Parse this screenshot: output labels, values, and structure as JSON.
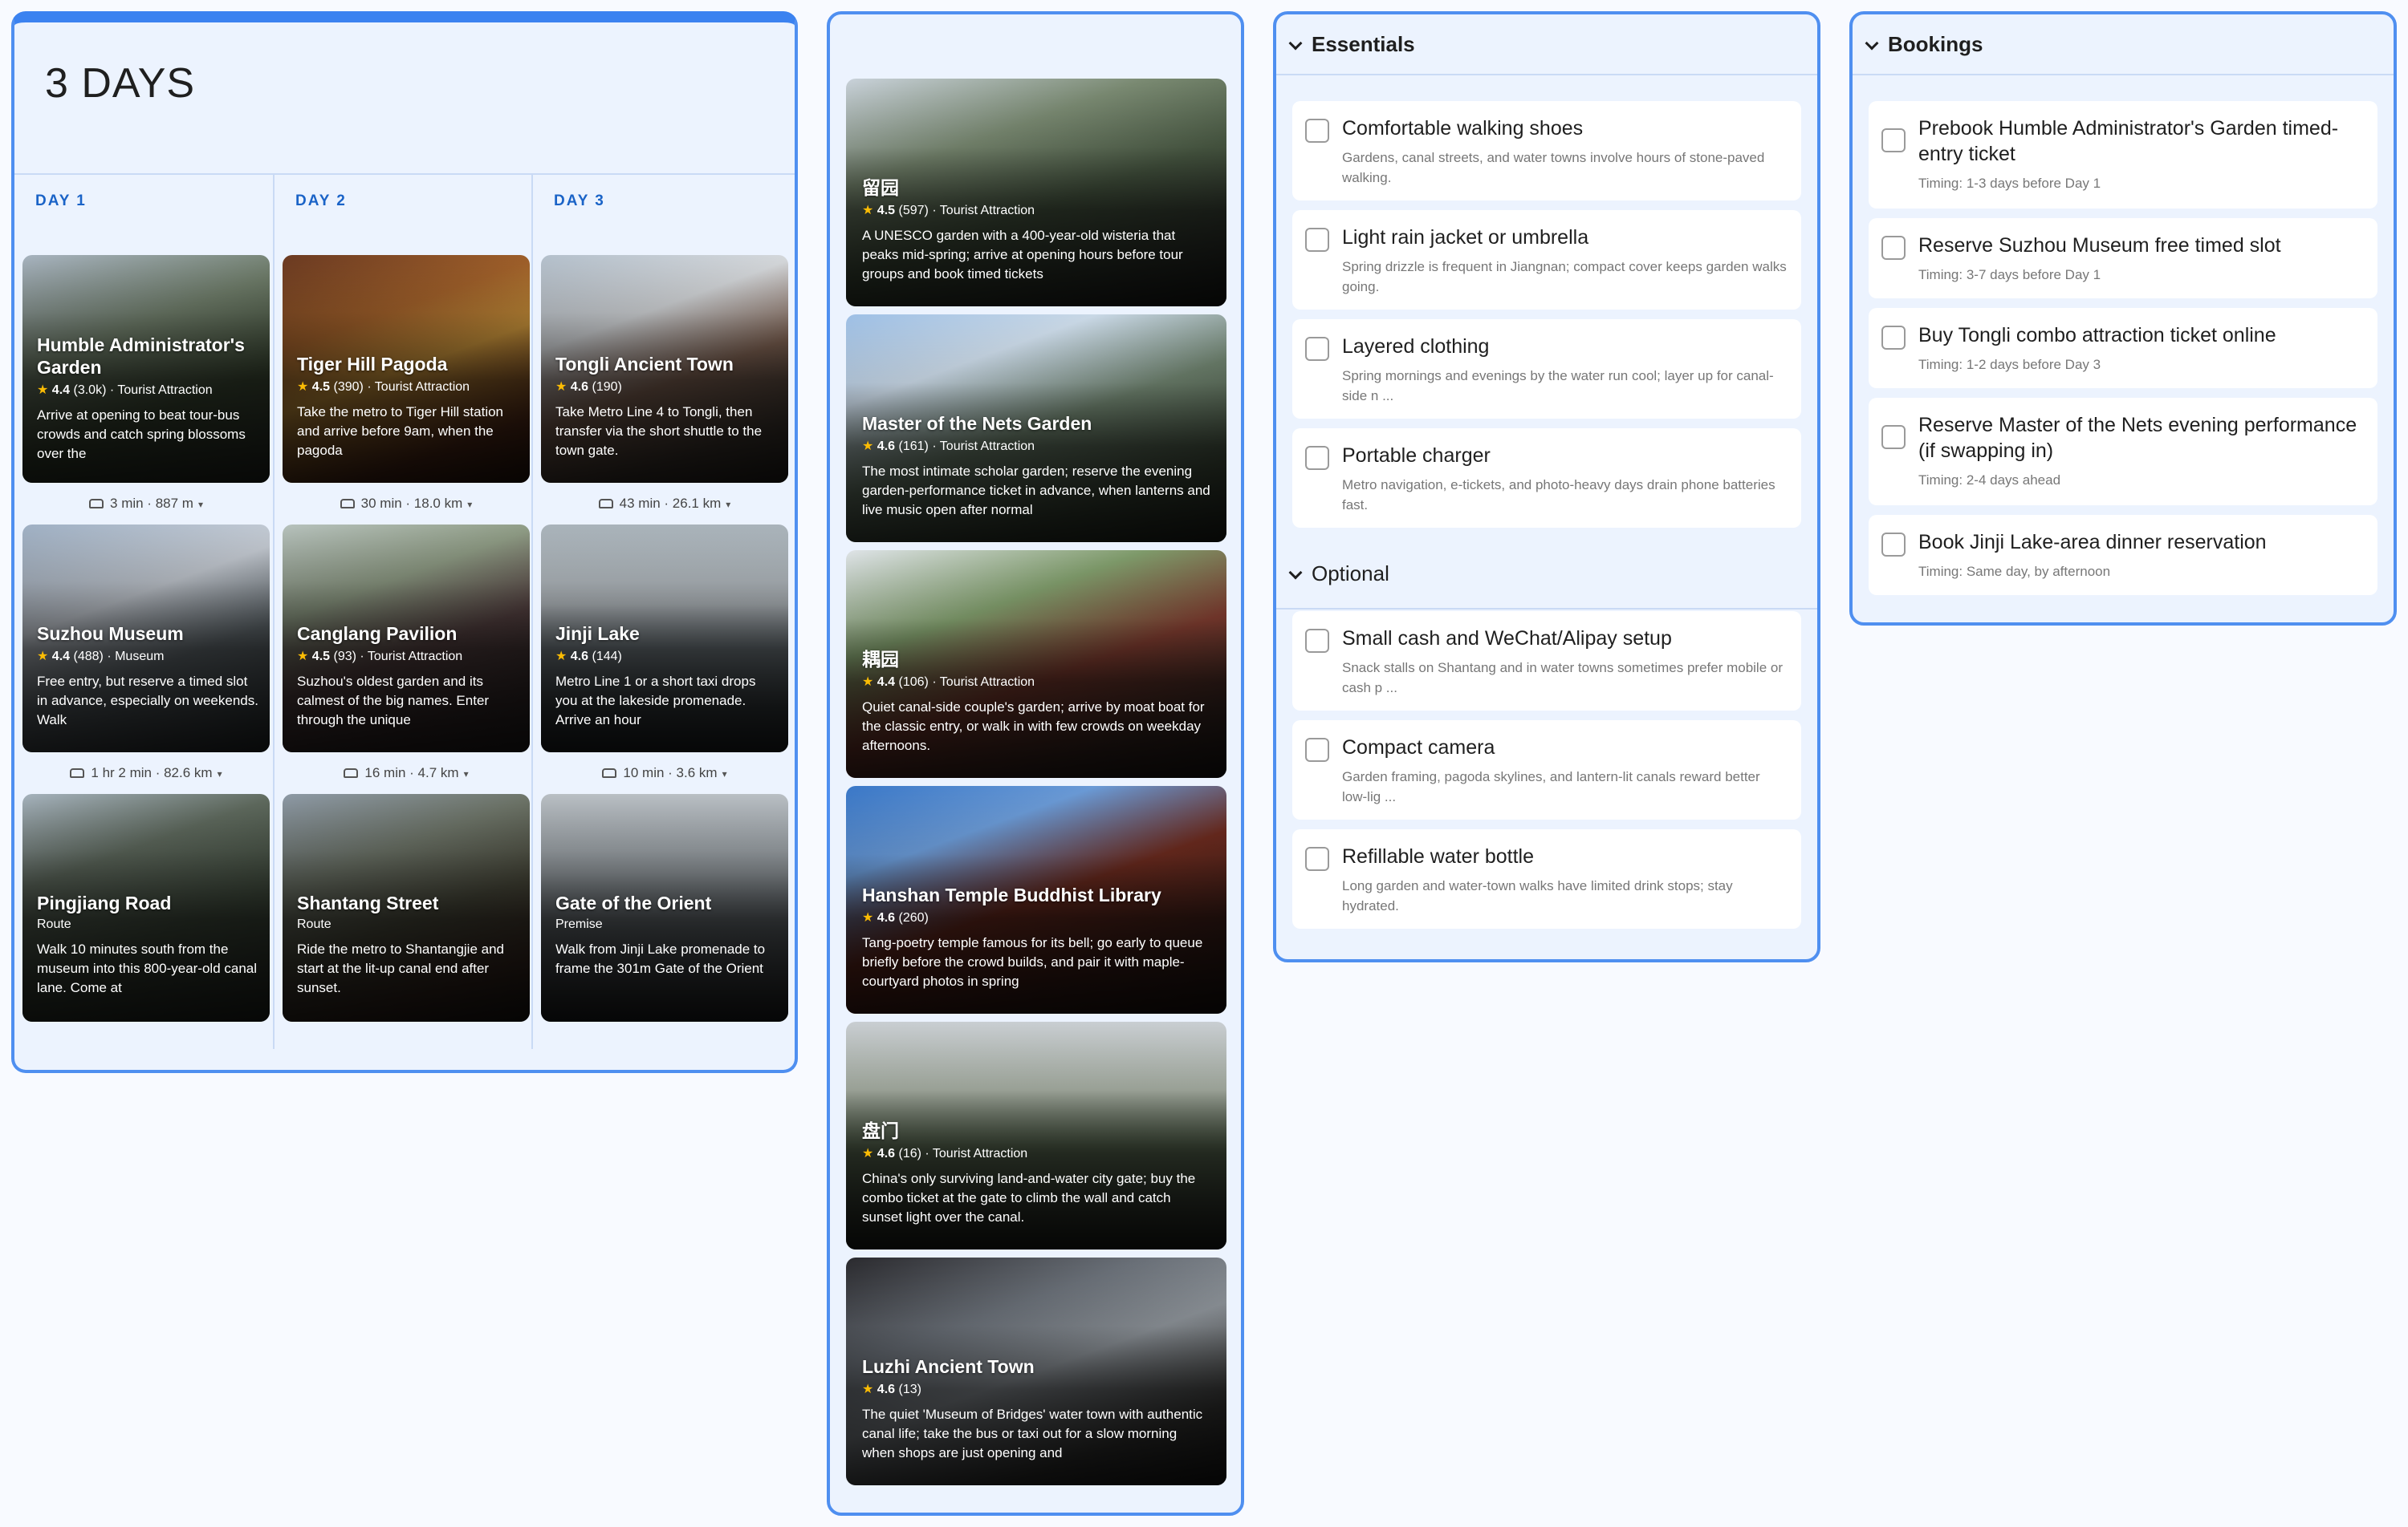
{
  "trip": {
    "title": "3 DAYS",
    "days": [
      {
        "label": "DAY 1",
        "stops": [
          {
            "name": "Humble Administrator's Garden",
            "rating": "4.4",
            "reviews": "(3.0k)",
            "category": "· Tourist Attraction",
            "desc": "Arrive at opening to beat tour-bus crowds and catch spring blossoms over the"
          },
          {
            "name": "Suzhou Museum",
            "rating": "4.4",
            "reviews": "(488)",
            "category": "· Museum",
            "desc": "Free entry, but reserve a timed slot in advance, especially on weekends. Walk"
          },
          {
            "name": "Pingjiang Road",
            "rating": "",
            "reviews": "",
            "category": "Route",
            "desc": "Walk 10 minutes south from the museum into this 800-year-old canal lane. Come at"
          }
        ],
        "travel": [
          "3 min · 887 m",
          "1 hr 2 min · 82.6 km"
        ]
      },
      {
        "label": "DAY 2",
        "stops": [
          {
            "name": "Tiger Hill Pagoda",
            "rating": "4.5",
            "reviews": "(390)",
            "category": "· Tourist Attraction",
            "desc": "Take the metro to Tiger Hill station and arrive before 9am, when the pagoda"
          },
          {
            "name": "Canglang Pavilion",
            "rating": "4.5",
            "reviews": "(93)",
            "category": "· Tourist Attraction",
            "desc": "Suzhou's oldest garden and its calmest of the big names. Enter through the unique"
          },
          {
            "name": "Shantang Street",
            "rating": "",
            "reviews": "",
            "category": "Route",
            "desc": "Ride the metro to Shantangjie and start at the lit-up canal end after sunset."
          }
        ],
        "travel": [
          "30 min · 18.0 km",
          "16 min · 4.7 km"
        ]
      },
      {
        "label": "DAY 3",
        "stops": [
          {
            "name": "Tongli Ancient Town",
            "rating": "4.6",
            "reviews": "(190)",
            "category": "",
            "desc": "Take Metro Line 4 to Tongli, then transfer via the short shuttle to the town gate."
          },
          {
            "name": "Jinji Lake",
            "rating": "4.6",
            "reviews": "(144)",
            "category": "",
            "desc": "Metro Line 1 or a short taxi drops you at the lakeside promenade. Arrive an hour"
          },
          {
            "name": "Gate of the Orient",
            "rating": "",
            "reviews": "",
            "category": "Premise",
            "desc": "Walk from Jinji Lake promenade to frame the 301m Gate of the Orient"
          }
        ],
        "travel": [
          "43 min · 26.1 km",
          "10 min · 3.6 km"
        ]
      }
    ]
  },
  "places": [
    {
      "name": "留园",
      "rating": "4.5",
      "reviews": "(597)",
      "category": "· Tourist Attraction",
      "desc": "A UNESCO garden with a 400-year-old wisteria that peaks mid-spring; arrive at opening hours before tour groups and book timed tickets"
    },
    {
      "name": "Master of the Nets Garden",
      "rating": "4.6",
      "reviews": "(161)",
      "category": "· Tourist Attraction",
      "desc": "The most intimate scholar garden; reserve the evening garden-performance ticket in advance, when lanterns and live music open after normal"
    },
    {
      "name": "耦园",
      "rating": "4.4",
      "reviews": "(106)",
      "category": "· Tourist Attraction",
      "desc": "Quiet canal-side couple's garden; arrive by moat boat for the classic entry, or walk in with few crowds on weekday afternoons."
    },
    {
      "name": "Hanshan Temple Buddhist Library",
      "rating": "4.6",
      "reviews": "(260)",
      "category": "",
      "desc": "Tang-poetry temple famous for its bell; go early to queue briefly before the crowd builds, and pair it with maple-courtyard photos in spring"
    },
    {
      "name": "盘门",
      "rating": "4.6",
      "reviews": "(16)",
      "category": "· Tourist Attraction",
      "desc": "China's only surviving land-and-water city gate; buy the combo ticket at the gate to climb the wall and catch sunset light over the canal."
    },
    {
      "name": "Luzhi Ancient Town",
      "rating": "4.6",
      "reviews": "(13)",
      "category": "",
      "desc": "The quiet 'Museum of Bridges' water town with authentic canal life; take the bus or taxi out for a slow morning when shops are just opening and"
    }
  ],
  "packing": {
    "essentials": {
      "title": "Essentials",
      "items": [
        {
          "title": "Comfortable walking shoes",
          "sub": "Gardens, canal streets, and water towns involve hours of stone-paved walking."
        },
        {
          "title": "Light rain jacket or umbrella",
          "sub": "Spring drizzle is frequent in Jiangnan; compact cover keeps garden walks going."
        },
        {
          "title": "Layered clothing",
          "sub": "Spring mornings and evenings by the water run cool; layer up for canal-side n ..."
        },
        {
          "title": "Portable charger",
          "sub": "Metro navigation, e-tickets, and photo-heavy days drain phone batteries fast."
        }
      ]
    },
    "optional": {
      "title": "Optional",
      "items": [
        {
          "title": "Small cash and WeChat/Alipay setup",
          "sub": "Snack stalls on Shantang and in water towns sometimes prefer mobile or cash p ..."
        },
        {
          "title": "Compact camera",
          "sub": "Garden framing, pagoda skylines, and lantern-lit canals reward better low-lig ..."
        },
        {
          "title": "Refillable water bottle",
          "sub": "Long garden and water-town walks have limited drink stops; stay hydrated."
        }
      ]
    }
  },
  "bookings": {
    "title": "Bookings",
    "items": [
      {
        "title": "Prebook Humble Administrator's Garden timed-entry ticket",
        "sub": "Timing: 1-3 days before Day 1"
      },
      {
        "title": "Reserve Suzhou Museum free timed slot",
        "sub": "Timing: 3-7 days before Day 1"
      },
      {
        "title": "Buy Tongli combo attraction ticket online",
        "sub": "Timing: 1-2 days before Day 3"
      },
      {
        "title": "Reserve Master of the Nets evening performance (if swapping in)",
        "sub": "Timing: 2-4 days ahead"
      },
      {
        "title": "Book Jinji Lake-area dinner reservation",
        "sub": "Timing: Same day, by afternoon"
      }
    ]
  },
  "icons": {
    "travel_mode": "car-icon",
    "expand": "chevron-down-icon",
    "rating": "star-icon",
    "checkbox": "checkbox-icon"
  },
  "colors": {
    "accent": "#3b82f0",
    "panel_bg": "#ecf3fe",
    "day_label": "#1a63c7",
    "star": "#fbbc04"
  }
}
